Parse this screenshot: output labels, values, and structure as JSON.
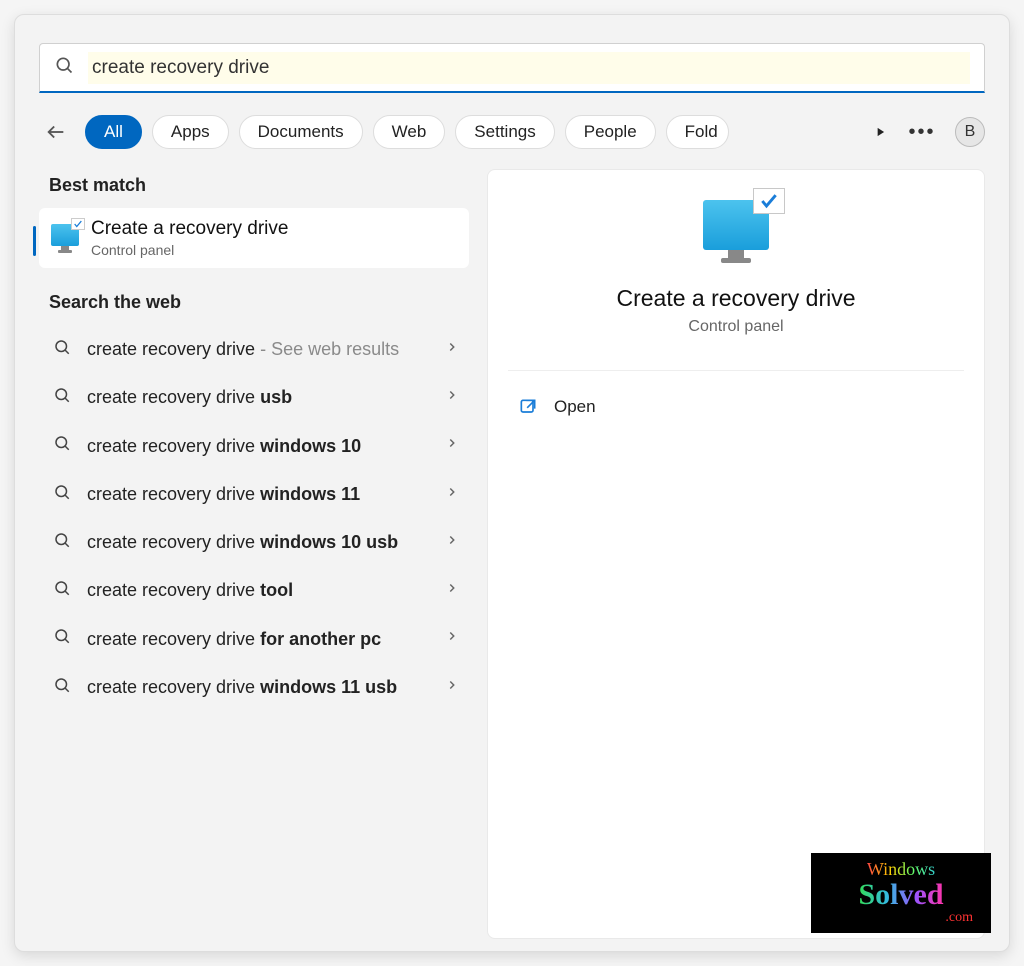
{
  "search": {
    "value": "create recovery drive"
  },
  "tabs": {
    "items": [
      "All",
      "Apps",
      "Documents",
      "Web",
      "Settings",
      "People",
      "Fold"
    ],
    "active_index": 0
  },
  "avatar_initial": "B",
  "best_match": {
    "title_html": "<span class='bold'>Create</span> a <span class='bold'>recovery drive</span>",
    "subtitle": "Control panel"
  },
  "sections": {
    "best_match_label": "Best match",
    "search_web_label": "Search the web"
  },
  "web_results": [
    {
      "norm": "create recovery drive",
      "bold": "",
      "hint": " - See web results"
    },
    {
      "norm": "create recovery drive ",
      "bold": "usb",
      "hint": ""
    },
    {
      "norm": "create recovery drive ",
      "bold": "windows 10",
      "hint": ""
    },
    {
      "norm": "create recovery drive ",
      "bold": "windows 11",
      "hint": ""
    },
    {
      "norm": "create recovery drive ",
      "bold": "windows 10 usb",
      "hint": ""
    },
    {
      "norm": "create recovery drive ",
      "bold": "tool",
      "hint": ""
    },
    {
      "norm": "create recovery drive ",
      "bold": "for another pc",
      "hint": ""
    },
    {
      "norm": "create recovery drive ",
      "bold": "windows 11 usb",
      "hint": ""
    }
  ],
  "detail": {
    "title": "Create a recovery drive",
    "subtitle": "Control panel",
    "open_label": "Open"
  },
  "watermark": {
    "l1": "Windows",
    "l2": "Solved",
    "l3": ".com"
  }
}
